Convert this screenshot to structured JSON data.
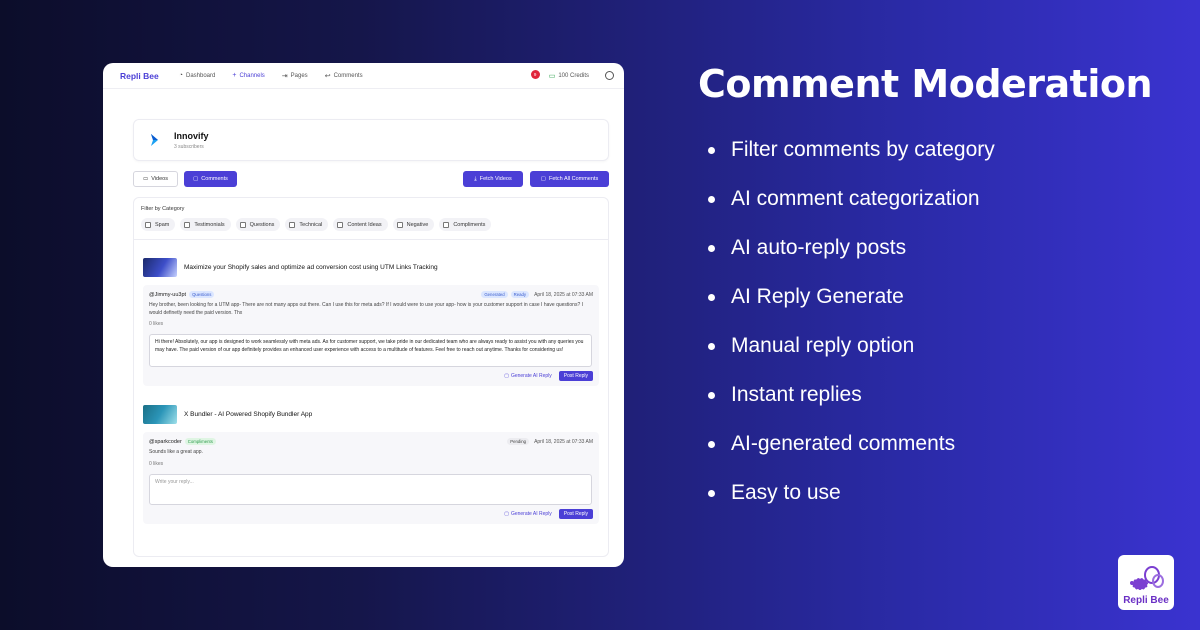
{
  "app": {
    "brand": "Repli Bee",
    "nav": [
      {
        "label": "Dashboard",
        "icon": "gauge-icon"
      },
      {
        "label": "Channels",
        "icon": "plus-icon",
        "active": true
      },
      {
        "label": "Pages",
        "icon": "arrow-right-icon"
      },
      {
        "label": "Comments",
        "icon": "reply-icon"
      }
    ],
    "notifications_count": "9",
    "credits": "100 Credits"
  },
  "channel": {
    "name": "Innovify",
    "subscribers": "3 subscribers"
  },
  "toolbar": {
    "videos_label": "Videos",
    "comments_label": "Comments",
    "fetch_videos_label": "Fetch Videos",
    "fetch_all_label": "Fetch All Comments"
  },
  "filter": {
    "title": "Filter by Category",
    "categories": [
      "Spam",
      "Testimonials",
      "Questions",
      "Technical",
      "Content Ideas",
      "Negative",
      "Compliments"
    ]
  },
  "posts": [
    {
      "title": "Maximize your Shopify sales and optimize ad conversion cost using UTM Links Tracking",
      "comment": {
        "user": "@Jimmy-uu3pt",
        "tag": "Questions",
        "statuses": [
          "Generated",
          "Ready"
        ],
        "date": "April 18, 2025 at 07:33 AM",
        "text": "Hey brother, been looking for a UTM app- There are not many apps out there. Can I use this for meta ads? If I would were to use your app- how is your customer support in case I have questions? I would definetly need the paid version. Thx",
        "likes": "0 likes",
        "reply": "Hi there! Absolutely, our app is designed to work seamlessly with meta ads. As for customer support, we take pride in our dedicated team who are always ready to assist you with any queries you may have. The paid version of our app definitely provides an enhanced user experience with access to a multitude of features. Feel free to reach out anytime. Thanks for considering us!"
      }
    },
    {
      "title": "X Bundler - AI Powered Shopify Bundler App",
      "comment": {
        "user": "@sparkcoder",
        "tag": "Compliments",
        "statuses": [
          "Pending"
        ],
        "date": "April 18, 2025 at 07:33 AM",
        "text": "Sounds like a great app.",
        "likes": "0 likes",
        "reply_placeholder": "Write your reply..."
      }
    }
  ],
  "actions": {
    "generate_label": "Generate AI Reply",
    "post_label": "Post Reply"
  },
  "marketing": {
    "headline": "Comment Moderation",
    "features": [
      "Filter comments by category",
      "AI comment categorization",
      "AI auto-reply posts",
      "AI Reply Generate",
      "Manual reply option",
      "Instant replies",
      "AI-generated comments",
      "Easy to use"
    ],
    "badge_text": "Repli Bee"
  },
  "colors": {
    "accent": "#4b3fd6",
    "badge_text": "#6a2fc4"
  }
}
